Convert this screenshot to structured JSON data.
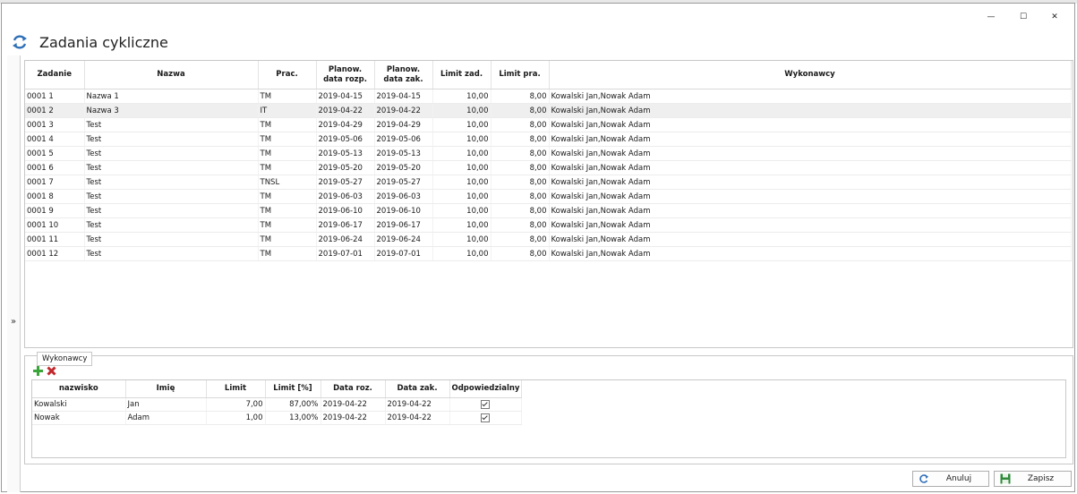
{
  "window": {
    "title": "Zadania cykliczne",
    "controls": [
      "—",
      "☐",
      "✕"
    ]
  },
  "sidebar": {
    "expand_glyph": "»"
  },
  "tasks_table": {
    "headers": [
      "Zadanie",
      "Nazwa",
      "Prac.",
      "Planow. data rozp.",
      "Planow. data zak.",
      "Limit zad.",
      "Limit pra.",
      "Wykonawcy"
    ],
    "rows": [
      [
        "0001 1",
        "Nazwa 1",
        "TM",
        "2019-04-15",
        "2019-04-15",
        "10,00",
        "8,00",
        "Kowalski Jan,Nowak Adam"
      ],
      [
        "0001 2",
        "Nazwa 3",
        "IT",
        "2019-04-22",
        "2019-04-22",
        "10,00",
        "8,00",
        "Kowalski Jan,Nowak Adam"
      ],
      [
        "0001 3",
        "Test",
        "TM",
        "2019-04-29",
        "2019-04-29",
        "10,00",
        "8,00",
        "Kowalski Jan,Nowak Adam"
      ],
      [
        "0001 4",
        "Test",
        "TM",
        "2019-05-06",
        "2019-05-06",
        "10,00",
        "8,00",
        "Kowalski Jan,Nowak Adam"
      ],
      [
        "0001 5",
        "Test",
        "TM",
        "2019-05-13",
        "2019-05-13",
        "10,00",
        "8,00",
        "Kowalski Jan,Nowak Adam"
      ],
      [
        "0001 6",
        "Test",
        "TM",
        "2019-05-20",
        "2019-05-20",
        "10,00",
        "8,00",
        "Kowalski Jan,Nowak Adam"
      ],
      [
        "0001 7",
        "Test",
        "TNSL",
        "2019-05-27",
        "2019-05-27",
        "10,00",
        "8,00",
        "Kowalski Jan,Nowak Adam"
      ],
      [
        "0001 8",
        "Test",
        "TM",
        "2019-06-03",
        "2019-06-03",
        "10,00",
        "8,00",
        "Kowalski Jan,Nowak Adam"
      ],
      [
        "0001 9",
        "Test",
        "TM",
        "2019-06-10",
        "2019-06-10",
        "10,00",
        "8,00",
        "Kowalski Jan,Nowak Adam"
      ],
      [
        "0001 10",
        "Test",
        "TM",
        "2019-06-17",
        "2019-06-17",
        "10,00",
        "8,00",
        "Kowalski Jan,Nowak Adam"
      ],
      [
        "0001 11",
        "Test",
        "TM",
        "2019-06-24",
        "2019-06-24",
        "10,00",
        "8,00",
        "Kowalski Jan,Nowak Adam"
      ],
      [
        "0001 12",
        "Test",
        "TM",
        "2019-07-01",
        "2019-07-01",
        "10,00",
        "8,00",
        "Kowalski Jan,Nowak Adam"
      ]
    ]
  },
  "executors_panel": {
    "tab_label": "Wykonawcy",
    "headers": [
      "nazwisko",
      "Imię",
      "Limit",
      "Limit [%]",
      "Data roz.",
      "Data zak.",
      "Odpowiedzialny"
    ],
    "rows": [
      [
        "Kowalski",
        "Jan",
        "7,00",
        "87,00%",
        "2019-04-22",
        "2019-04-22",
        true
      ],
      [
        "Nowak",
        "Adam",
        "1,00",
        "13,00%",
        "2019-04-22",
        "2019-04-22",
        true
      ]
    ]
  },
  "buttons": {
    "cancel": "Anuluj",
    "save": "Zapisz"
  },
  "icons": {
    "title": "refresh-cycle-icon",
    "add": "plus-icon",
    "delete": "x-icon",
    "cancel": "cancel-icon",
    "save": "floppy-disk-icon"
  },
  "colors": {
    "title_icon": "#2f6fb7",
    "add_icon": "#3aa63a",
    "delete_icon": "#c0282d",
    "selected_row": "#efefef"
  }
}
